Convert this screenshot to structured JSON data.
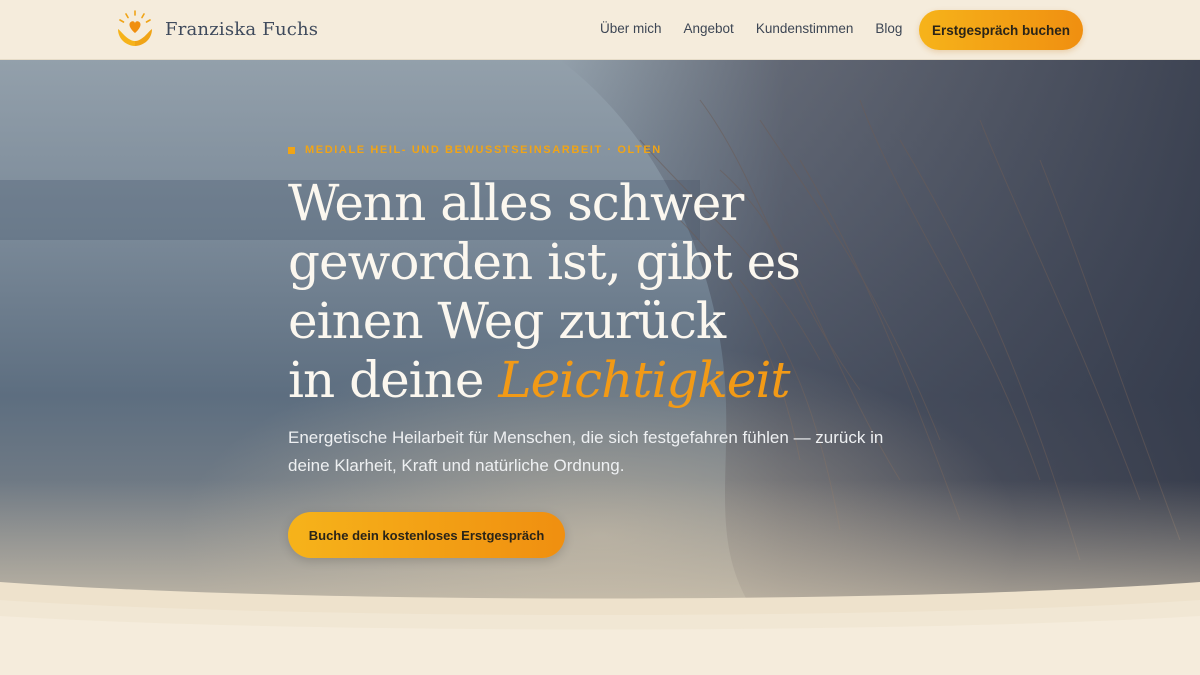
{
  "header": {
    "brand_name": "Franziska Fuchs",
    "logo_icon": "heart-in-hands-icon",
    "nav": [
      {
        "label": "Über mich"
      },
      {
        "label": "Angebot"
      },
      {
        "label": "Kundenstimmen"
      },
      {
        "label": "Blog"
      }
    ],
    "cta_label": "Erstgespräch buchen"
  },
  "hero": {
    "eyebrow": "MEDIALE HEIL- UND BEWUSSTSEINSARBEIT · OLTEN",
    "title_lines": [
      "Wenn alles schwer",
      "geworden ist, gibt es",
      "einen Weg zurück"
    ],
    "title_last_prefix": "in deine ",
    "title_accent": "Leichtigkeit",
    "subtitle": "Energetische Heilarbeit für Menschen, die sich festgefahren fühlen — zurück in deine Klarheit, Kraft und natürliche Ordnung.",
    "cta_label": "Buche dein kostenloses Erstgespräch"
  },
  "colors": {
    "accent": "#f29a16",
    "cream": "#f5ecdc",
    "navy_text": "#3f4a5c"
  }
}
